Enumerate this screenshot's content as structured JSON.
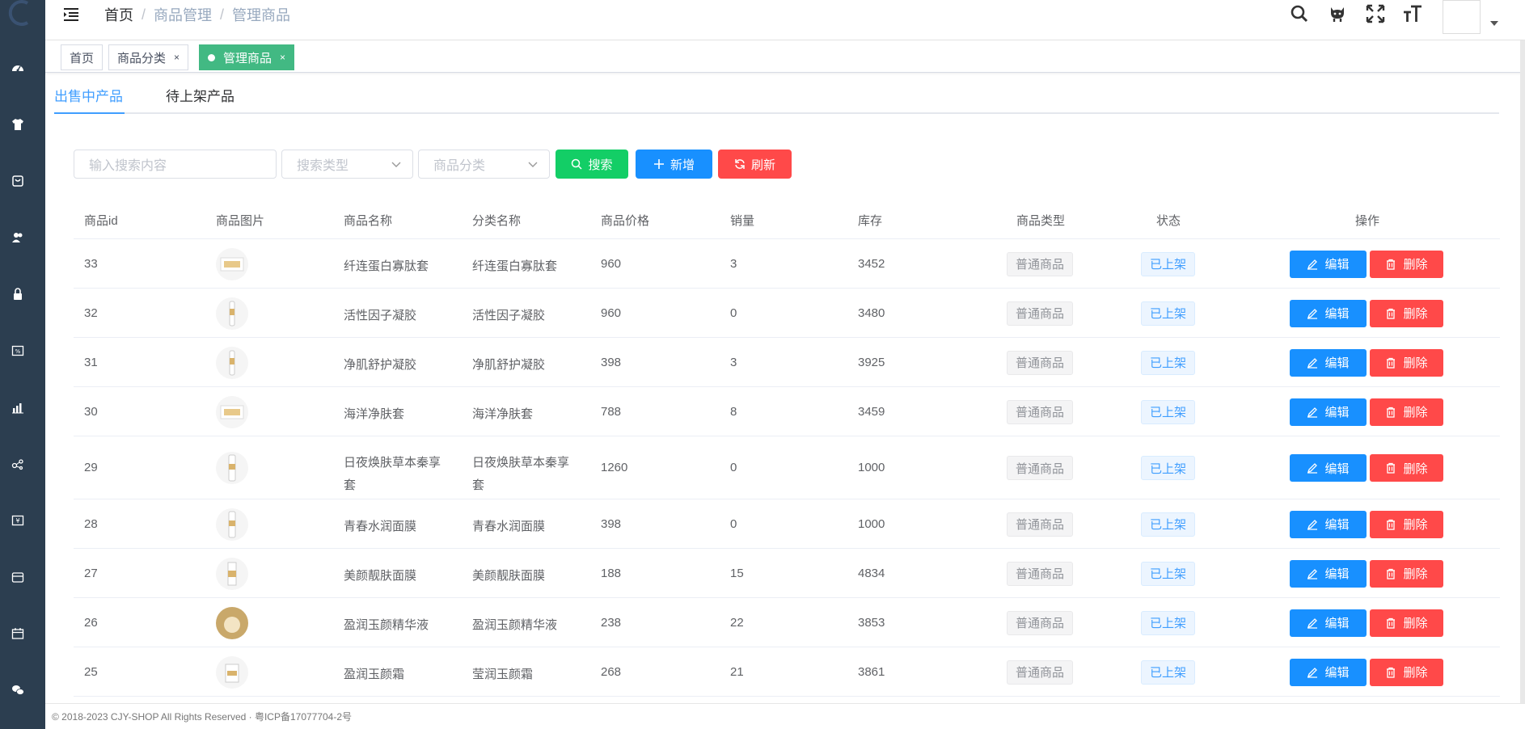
{
  "sidebar": {
    "icons": [
      "dashboard-icon",
      "shirt-icon",
      "cart-icon",
      "users-icon",
      "lock-icon",
      "coupon-icon",
      "chart-icon",
      "share-icon",
      "finance-icon",
      "store-icon",
      "calendar-icon",
      "wechat-icon"
    ]
  },
  "breadcrumb": {
    "home": "首页",
    "sep": "/",
    "level1": "商品管理",
    "level2": "管理商品"
  },
  "header_icons": [
    "search-icon",
    "github-icon",
    "fullscreen-icon",
    "font-size-icon"
  ],
  "tags": [
    {
      "label": "首页",
      "closable": false
    },
    {
      "label": "商品分类",
      "closable": true,
      "close": "×"
    },
    {
      "label": "管理商品",
      "closable": true,
      "close": "×",
      "active": true
    }
  ],
  "tabs": {
    "selling": "出售中产品",
    "pending": "待上架产品"
  },
  "filters": {
    "search_placeholder": "输入搜索内容",
    "type_placeholder": "搜索类型",
    "category_placeholder": "商品分类",
    "search_btn": "搜索",
    "add_btn": "新增",
    "refresh_btn": "刷新"
  },
  "table": {
    "headers": {
      "id": "商品id",
      "image": "商品图片",
      "name": "商品名称",
      "category": "分类名称",
      "price": "商品价格",
      "sales": "销量",
      "stock": "库存",
      "type": "商品类型",
      "status": "状态",
      "ops": "操作"
    },
    "edit_label": "编辑",
    "delete_label": "删除",
    "rows": [
      {
        "id": "33",
        "name": "纤连蛋白寡肽套",
        "category": "纤连蛋白寡肽套",
        "price": "960",
        "sales": "3",
        "stock": "3452",
        "type": "普通商品",
        "status": "已上架"
      },
      {
        "id": "32",
        "name": "活性因子凝胶",
        "category": "活性因子凝胶",
        "price": "960",
        "sales": "0",
        "stock": "3480",
        "type": "普通商品",
        "status": "已上架"
      },
      {
        "id": "31",
        "name": "净肌舒护凝胶",
        "category": "净肌舒护凝胶",
        "price": "398",
        "sales": "3",
        "stock": "3925",
        "type": "普通商品",
        "status": "已上架"
      },
      {
        "id": "30",
        "name": "海洋净肤套",
        "category": "海洋净肤套",
        "price": "788",
        "sales": "8",
        "stock": "3459",
        "type": "普通商品",
        "status": "已上架"
      },
      {
        "id": "29",
        "name": "日夜焕肤草本秦享套",
        "category": "日夜焕肤草本秦享套",
        "price": "1260",
        "sales": "0",
        "stock": "1000",
        "type": "普通商品",
        "status": "已上架"
      },
      {
        "id": "28",
        "name": "青春水润面膜",
        "category": "青春水润面膜",
        "price": "398",
        "sales": "0",
        "stock": "1000",
        "type": "普通商品",
        "status": "已上架"
      },
      {
        "id": "27",
        "name": "美颜靓肤面膜",
        "category": "美颜靓肤面膜",
        "price": "188",
        "sales": "15",
        "stock": "4834",
        "type": "普通商品",
        "status": "已上架"
      },
      {
        "id": "26",
        "name": "盈润玉颜精华液",
        "category": "盈润玉颜精华液",
        "price": "238",
        "sales": "22",
        "stock": "3853",
        "type": "普通商品",
        "status": "已上架"
      },
      {
        "id": "25",
        "name": "盈润玉颜霜",
        "category": "莹润玉颜霜",
        "price": "268",
        "sales": "21",
        "stock": "3861",
        "type": "普通商品",
        "status": "已上架"
      }
    ]
  },
  "footer": "© 2018-2023 CJY-SHOP All Rights Reserved · 粤ICP备17077704-2号",
  "colors": {
    "sidebar": "#2c3e50",
    "active_tag": "#42b983",
    "primary": "#1890ff",
    "danger": "#ff4949",
    "success": "#13ce66"
  }
}
